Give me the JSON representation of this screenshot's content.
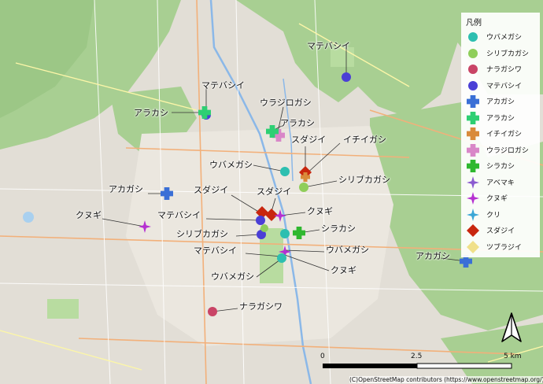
{
  "map": {
    "labels": {
      "matebashii_ne": "マテバシイ",
      "matebashii_nw": "マテバシイ",
      "arakashi_nw": "アラカシ",
      "urajirogashi": "ウラジロガシ",
      "arakashi_c": "アラカシ",
      "sudajii_ne": "スダジイ",
      "ichiigashi": "イチイガシ",
      "ubamegashi_1": "ウバメガシ",
      "shiribukagashi_1": "シリブカガシ",
      "akagashi_w": "アカガシ",
      "sudajii_w": "スダジイ",
      "sudajii_c": "スダジイ",
      "kunugi_w": "クヌギ",
      "matebashii_c": "マテバシイ",
      "kunugi_c": "クヌギ",
      "shirakashi": "シラカシ",
      "shiribukagashi_2": "シリブカガシ",
      "matebashii_s": "マテバシイ",
      "ubamegashi_2": "ウバメガシ",
      "akagashi_e": "アカガシ",
      "kunugi_s": "クヌギ",
      "ubamegashi_3": "ウバメガシ",
      "naragashiwa": "ナラガシワ"
    },
    "points": [
      {
        "name": "matebashii-ne",
        "species": "マテバシイ",
        "symbol": "circle",
        "color": "#4b3fd6"
      },
      {
        "name": "matebashii-nw",
        "species": "マテバシイ",
        "symbol": "circle",
        "color": "#4b3fd6"
      },
      {
        "name": "arakashi-nw",
        "species": "アラカシ",
        "symbol": "cross",
        "color": "#2ecf73"
      },
      {
        "name": "urajirogashi",
        "species": "ウラジロガシ",
        "symbol": "cross",
        "color": "#d987c8"
      },
      {
        "name": "arakashi-c",
        "species": "アラカシ",
        "symbol": "cross",
        "color": "#2ecf73"
      },
      {
        "name": "sudajii-ne",
        "species": "スダジイ",
        "symbol": "diamond",
        "color": "#c8260e"
      },
      {
        "name": "ichiigashi",
        "species": "イチイガシ",
        "symbol": "cross",
        "color": "#d98a3a"
      },
      {
        "name": "ubamegashi-1",
        "species": "ウバメガシ",
        "symbol": "circle",
        "color": "#2dbfb0"
      },
      {
        "name": "shiribukagashi-1",
        "species": "シリブカガシ",
        "symbol": "circle",
        "color": "#8fce5a"
      },
      {
        "name": "akagashi-w",
        "species": "アカガシ",
        "symbol": "cross",
        "color": "#3a6fd6"
      },
      {
        "name": "sudajii-w",
        "species": "スダジイ",
        "symbol": "diamond",
        "color": "#c8260e"
      },
      {
        "name": "sudajii-c",
        "species": "スダジイ",
        "symbol": "diamond",
        "color": "#c8260e"
      },
      {
        "name": "kunugi-c",
        "species": "クヌギ",
        "symbol": "star",
        "color": "#b52fd1"
      },
      {
        "name": "kunugi-w",
        "species": "クヌギ",
        "symbol": "star",
        "color": "#b52fd1"
      },
      {
        "name": "matebashii-c",
        "species": "マテバシイ",
        "symbol": "circle",
        "color": "#4b3fd6"
      },
      {
        "name": "matebashii-s",
        "species": "マテバシイ",
        "symbol": "circle",
        "color": "#4b3fd6"
      },
      {
        "name": "shiribukagashi-2",
        "species": "シリブカガシ",
        "symbol": "circle",
        "color": "#8fce5a"
      },
      {
        "name": "shirakashi",
        "species": "シラカシ",
        "symbol": "cross",
        "color": "#2fb82f"
      },
      {
        "name": "ubamegashi-2",
        "species": "ウバメガシ",
        "symbol": "circle",
        "color": "#2dbfb0"
      },
      {
        "name": "kunugi-s",
        "species": "クヌギ",
        "symbol": "star",
        "color": "#b52fd1"
      },
      {
        "name": "ubamegashi-3",
        "species": "ウバメガシ",
        "symbol": "circle",
        "color": "#2dbfb0"
      },
      {
        "name": "akagashi-e",
        "species": "アカガシ",
        "symbol": "cross",
        "color": "#3a6fd6"
      },
      {
        "name": "naragashiwa",
        "species": "ナラガシワ",
        "symbol": "circle",
        "color": "#c94466"
      }
    ]
  },
  "legend": {
    "title": "凡例",
    "items": [
      {
        "label": "ウバメガシ",
        "symbol": "circle",
        "color": "#2dbfb0"
      },
      {
        "label": "シリブカガシ",
        "symbol": "circle",
        "color": "#8fce5a"
      },
      {
        "label": "ナラガシワ",
        "symbol": "circle",
        "color": "#c94466"
      },
      {
        "label": "マテバシイ",
        "symbol": "circle",
        "color": "#4b3fd6"
      },
      {
        "label": "アカガシ",
        "symbol": "cross",
        "color": "#3a6fd6"
      },
      {
        "label": "アラカシ",
        "symbol": "cross",
        "color": "#2ecf73"
      },
      {
        "label": "イチイガシ",
        "symbol": "cross",
        "color": "#d98a3a"
      },
      {
        "label": "ウラジロガシ",
        "symbol": "cross",
        "color": "#d987c8"
      },
      {
        "label": "シラカシ",
        "symbol": "cross",
        "color": "#2fb82f"
      },
      {
        "label": "アベマキ",
        "symbol": "star",
        "color": "#8a5ad0"
      },
      {
        "label": "クヌギ",
        "symbol": "star",
        "color": "#b52fd1"
      },
      {
        "label": "クリ",
        "symbol": "star",
        "color": "#3aa6d6"
      },
      {
        "label": "スダジイ",
        "symbol": "diamond",
        "color": "#c8260e"
      },
      {
        "label": "ツブラジイ",
        "symbol": "diamond",
        "color": "#f0e08a"
      }
    ]
  },
  "scalebar": {
    "label_start": "0",
    "label_mid": "2.5",
    "label_end": "5 km"
  },
  "attribution": "(C)OpenStreetMap contributors (https://www.openstreetmap.org/)"
}
